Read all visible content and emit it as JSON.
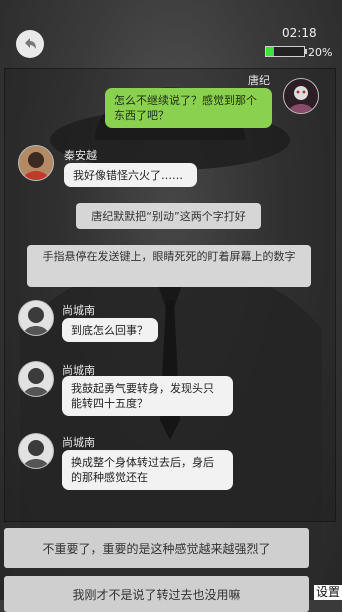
{
  "status_bar": {
    "time": "02:18",
    "battery_percent": "20%",
    "battery_level": 0.2
  },
  "messages": [
    {
      "type": "right",
      "sender": "唐纪",
      "text": "怎么不继续说了？感觉到那个东西了吧？"
    },
    {
      "type": "left",
      "sender": "秦安越",
      "text": "我好像错怪六火了……"
    },
    {
      "type": "narration",
      "text": "唐纪默默把“别动”这两个字打好"
    },
    {
      "type": "narration",
      "text": "手指悬停在发送键上，眼睛死死的盯着屏幕上的数字"
    },
    {
      "type": "left",
      "sender": "尚城南",
      "text": "到底怎么回事？"
    },
    {
      "type": "left",
      "sender": "尚城南",
      "text": "我鼓起勇气要转身，发现头只能转四十五度？"
    },
    {
      "type": "left",
      "sender": "尚城南",
      "text": "换成整个身体转过去后，身后的那种感觉还在"
    }
  ],
  "choices": [
    "不重要了，重要的是这种感觉越来越强烈了",
    "我刚才不是说了转过去也没用嘛"
  ],
  "corner_label": "设置",
  "icons": {
    "back": "back-arrow-icon"
  }
}
